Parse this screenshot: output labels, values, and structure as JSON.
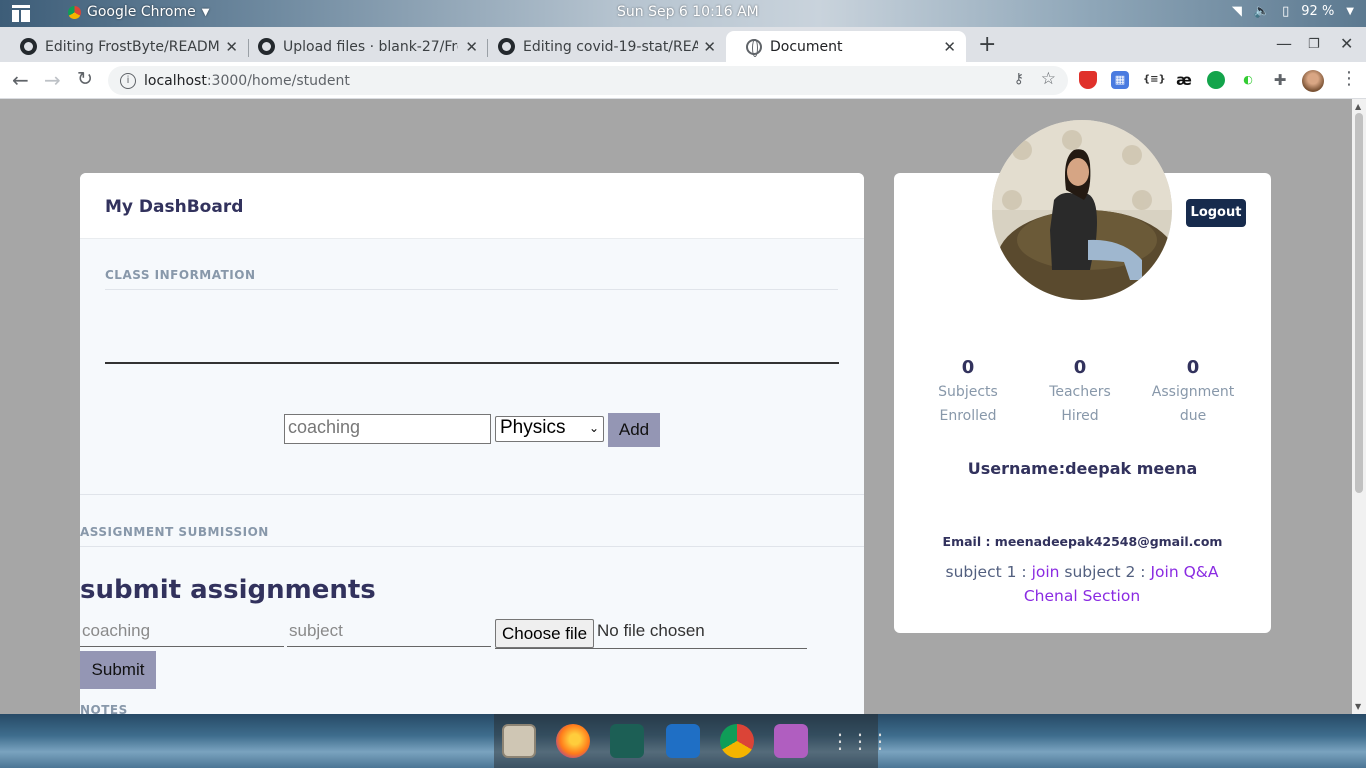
{
  "topbar": {
    "app_name": "Google Chrome",
    "clock": "Sun Sep 6  10:16 AM",
    "battery": "92 %"
  },
  "tabs": [
    {
      "title": "Editing FrostByte/READM"
    },
    {
      "title": "Upload files · blank-27/Fro"
    },
    {
      "title": "Editing covid-19-stat/REA"
    },
    {
      "title": "Document"
    }
  ],
  "address": {
    "host": "localhost",
    "rest": ":3000/home/student"
  },
  "dashboard": {
    "title": "My DashBoard",
    "class_info_label": "CLASS INFORMATION",
    "add_input_value": "coaching",
    "subject_select": "Physics",
    "add_button": "Add",
    "assignment_label": "ASSIGNMENT SUBMISSION",
    "submit_heading": "submit assignments",
    "coaching_placeholder": "coaching",
    "subject_placeholder": "subject",
    "choose_file": "Choose file",
    "no_file": "No file chosen",
    "submit_button": "Submit",
    "notes_label": "NOTES"
  },
  "profile": {
    "logout": "Logout",
    "stats": [
      {
        "value": "0",
        "line1": "Subjects",
        "line2": "Enrolled"
      },
      {
        "value": "0",
        "line1": "Teachers",
        "line2": "Hired"
      },
      {
        "value": "0",
        "line1": "Assignment",
        "line2": "due"
      }
    ],
    "username": "Username:deepak meena",
    "email": "Email : meenadeepak42548@gmail.com",
    "subject1_prefix": "subject 1 : ",
    "subject1_link": "join",
    "subject2_prefix": " subject 2 : ",
    "subject2_link": "Join Q&A Chenal Section"
  }
}
